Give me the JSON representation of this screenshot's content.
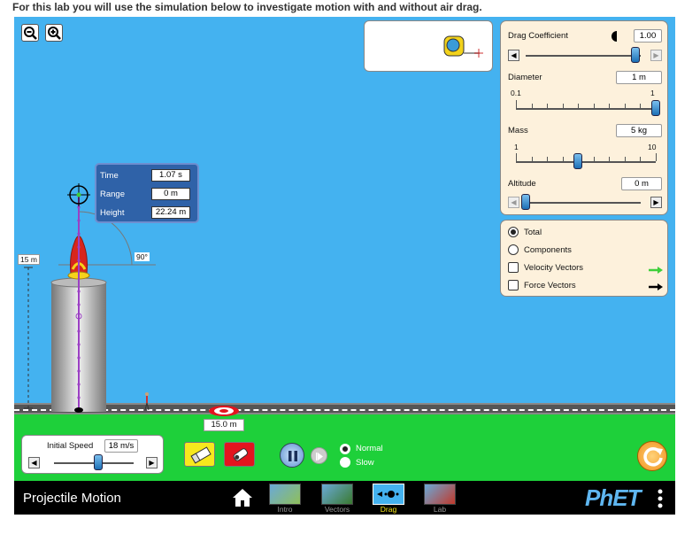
{
  "instruction": "For this lab you will use the simulation below to investigate motion with and without air drag.",
  "zoom": {
    "out_icon": "zoom-out-icon",
    "in_icon": "zoom-in-icon"
  },
  "tape_measure_icon": "tape-measure-icon",
  "drag_panel": {
    "drag_coefficient_label": "Drag Coefficient",
    "drag_coefficient_value": "1.00",
    "drag_coefficient_fraction": 0.95,
    "diameter_label": "Diameter",
    "diameter_value": "1 m",
    "diameter_min": "0.1",
    "diameter_max": "1",
    "diameter_fraction": 1.0,
    "mass_label": "Mass",
    "mass_value": "5 kg",
    "mass_min": "1",
    "mass_max": "10",
    "mass_fraction": 0.44,
    "altitude_label": "Altitude",
    "altitude_value": "0 m",
    "altitude_fraction": 0.0
  },
  "vectors_panel": {
    "total_label": "Total",
    "total_selected": true,
    "components_label": "Components",
    "velocity_label": "Velocity Vectors",
    "velocity_checked": false,
    "force_label": "Force Vectors",
    "force_checked": false,
    "velocity_color": "#3ecf3a",
    "force_color": "#000000"
  },
  "readout": {
    "time_label": "Time",
    "time_value": "1.07 s",
    "range_label": "Range",
    "range_value": "0 m",
    "height_label": "Height",
    "height_value": "22.24 m"
  },
  "cannon": {
    "angle_label": "90°",
    "height_label": "15 m"
  },
  "target": {
    "distance_label": "15.0 m"
  },
  "initial_speed": {
    "label": "Initial Speed",
    "value": "18 m/s",
    "fraction": 0.55
  },
  "controls": {
    "eraser_icon": "eraser-icon",
    "fire_icon": "fire-cannon-icon",
    "pause_icon": "pause-icon",
    "step_icon": "step-icon",
    "normal_label": "Normal",
    "slow_label": "Slow",
    "speed_selected": "Normal",
    "reset_icon": "reset-icon"
  },
  "navbar": {
    "title": "Projectile Motion",
    "home_icon": "home-icon",
    "tabs": [
      {
        "label": "Intro",
        "active": false
      },
      {
        "label": "Vectors",
        "active": false
      },
      {
        "label": "Drag",
        "active": true
      },
      {
        "label": "Lab",
        "active": false
      }
    ],
    "brand": "PhET",
    "menu_icon": "more-vertical-icon"
  },
  "colors": {
    "sky": "#44b2f0",
    "ground": "#1ed03a",
    "panel_bg": "#fdf1dc",
    "readout_bg": "#2f62a8",
    "trajectory": "#9b3fc4"
  }
}
